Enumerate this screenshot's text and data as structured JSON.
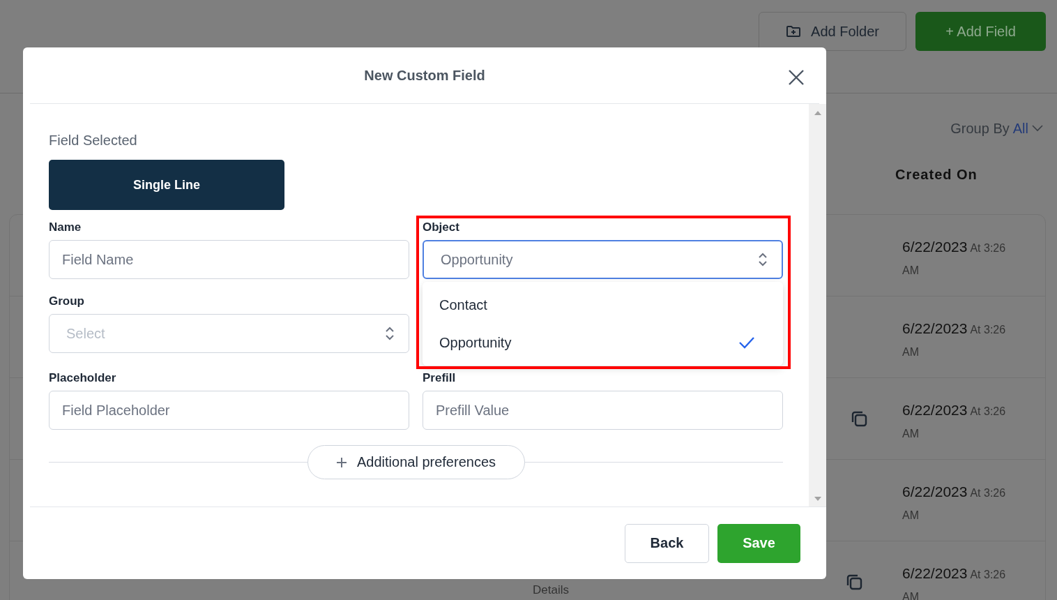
{
  "page": {
    "buttons": [
      {
        "label": "Add Folder",
        "kind": "outline"
      },
      {
        "label": "+ Add Field",
        "kind": "primary"
      }
    ],
    "group_by": {
      "label": "Group By",
      "value": "All"
    },
    "table": {
      "column": "Created On",
      "rows": [
        {
          "date": "6/22/2023",
          "time": "At 3:26",
          "meridiem": "AM",
          "copy": false
        },
        {
          "date": "6/22/2023",
          "time": "At 3:26",
          "meridiem": "AM",
          "copy": false
        },
        {
          "date": "6/22/2023",
          "time": "At 3:26",
          "meridiem": "AM",
          "copy": true
        },
        {
          "date": "6/22/2023",
          "time": "At 3:26",
          "meridiem": "AM",
          "copy": false
        },
        {
          "date": "6/22/2023",
          "time": "At 3:26",
          "meridiem": "AM",
          "copy": true,
          "details": "Details"
        }
      ]
    }
  },
  "modal": {
    "title": "New Custom Field",
    "field_selected_label": "Field Selected",
    "field_type": "Single Line",
    "rows": [
      [
        {
          "label": "Name",
          "kind": "input",
          "placeholder": "Field Name"
        },
        {
          "label": "Object",
          "kind": "select",
          "value": "Opportunity",
          "focused": true,
          "open": true,
          "options": [
            {
              "label": "Contact",
              "selected": false
            },
            {
              "label": "Opportunity",
              "selected": true
            }
          ]
        }
      ],
      [
        {
          "label": "Group",
          "kind": "select",
          "placeholder": "Select",
          "focused": false
        }
      ],
      [
        {
          "label": "Placeholder",
          "kind": "input",
          "placeholder": "Field Placeholder"
        },
        {
          "label": "Prefill",
          "kind": "input",
          "placeholder": "Prefill Value"
        }
      ]
    ],
    "preferences_button": "Additional preferences",
    "buttons": [
      {
        "label": "Back",
        "kind": "secondary"
      },
      {
        "label": "Save",
        "kind": "primary"
      }
    ]
  }
}
